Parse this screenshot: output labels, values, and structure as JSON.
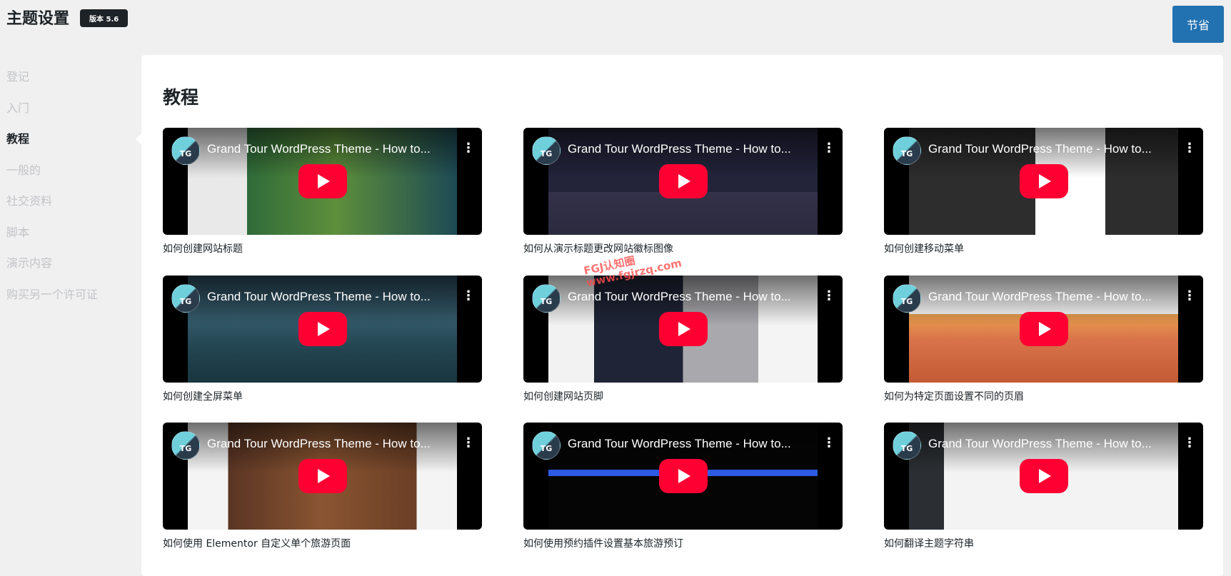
{
  "header": {
    "title": "主题设置",
    "version_badge": "版本 5.6",
    "save_label": "节省"
  },
  "sidebar": {
    "items": [
      {
        "label": "登记",
        "active": false
      },
      {
        "label": "入门",
        "active": false
      },
      {
        "label": "教程",
        "active": true
      },
      {
        "label": "一般的",
        "active": false
      },
      {
        "label": "社交资料",
        "active": false
      },
      {
        "label": "脚本",
        "active": false
      },
      {
        "label": "演示内容",
        "active": false
      },
      {
        "label": "购买另一个许可证",
        "active": false
      }
    ]
  },
  "main": {
    "title": "教程",
    "videos": [
      {
        "video_title": "Grand Tour WordPress Theme - How to...",
        "channel": "TG",
        "caption": "如何创建网站标题"
      },
      {
        "video_title": "Grand Tour WordPress Theme - How to...",
        "channel": "TG",
        "caption": "如何从演示标题更改网站徽标图像"
      },
      {
        "video_title": "Grand Tour WordPress Theme - How to...",
        "channel": "TG",
        "caption": "如何创建移动菜单"
      },
      {
        "video_title": "Grand Tour WordPress Theme - How to...",
        "channel": "TG",
        "caption": "如何创建全屏菜单"
      },
      {
        "video_title": "Grand Tour WordPress Theme - How to...",
        "channel": "TG",
        "caption": "如何创建网站页脚"
      },
      {
        "video_title": "Grand Tour WordPress Theme - How to...",
        "channel": "TG",
        "caption": "如何为特定页面设置不同的页眉"
      },
      {
        "video_title": "Grand Tour WordPress Theme - How to...",
        "channel": "TG",
        "caption": "如何使用 Elementor 自定义单个旅游页面"
      },
      {
        "video_title": "Grand Tour WordPress Theme - How to...",
        "channel": "TG",
        "caption": "如何使用预约插件设置基本旅游预订"
      },
      {
        "video_title": "Grand Tour WordPress Theme - How to...",
        "channel": "TG",
        "caption": "如何翻译主题字符串"
      }
    ]
  },
  "watermark": {
    "line1": "FGJ认知圈",
    "line2": "www.fgjrzq.com"
  },
  "colors": {
    "accent": "#2271b1",
    "play_button": "#ff0033",
    "page_background": "#f0f0f1",
    "panel_background": "#ffffff",
    "text": "#1d2327",
    "sidebar_inactive": "#c3c4c7"
  },
  "icons": {
    "play": "youtube-play-icon",
    "menu": "more-vertical-icon"
  }
}
